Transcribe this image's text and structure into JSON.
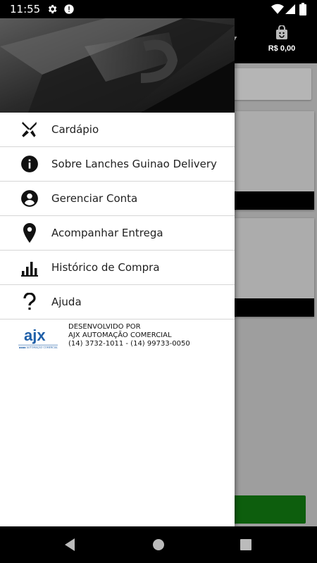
{
  "status_bar": {
    "time": "11:55",
    "icons": [
      "gear-icon",
      "alert-icon",
      "wifi-icon",
      "signal-icon",
      "battery-icon"
    ]
  },
  "app_bar": {
    "title_fragment": "y",
    "cart_total": "R$ 0,00"
  },
  "drawer": {
    "menu": [
      {
        "label": "Cardápio",
        "icon": "utensils-icon"
      },
      {
        "label": "Sobre Lanches Guinao Delivery",
        "icon": "info-icon"
      },
      {
        "label": "Gerenciar Conta",
        "icon": "account-icon"
      },
      {
        "label": "Acompanhar Entrega",
        "icon": "location-pin-icon"
      },
      {
        "label": "Histórico de Compra",
        "icon": "bar-chart-icon"
      },
      {
        "label": "Ajuda",
        "icon": "question-icon"
      }
    ],
    "credits": {
      "logo_text": "ajx",
      "logo_subtext": "AUTOMAÇÃO COMERCIAL",
      "line1": "DESENVOLVIDO POR",
      "line2": "AJX AUTOMAÇÃO COMERCIAL",
      "line3": "(14) 3732-1011 - (14) 99733-0050"
    }
  },
  "colors": {
    "status_bar": "#000000",
    "drawer_bg": "#ffffff",
    "scrim_bg": "#9e9e9e",
    "checkout_button": "#0d5e0d",
    "logo_blue": "#1f5fa8"
  }
}
